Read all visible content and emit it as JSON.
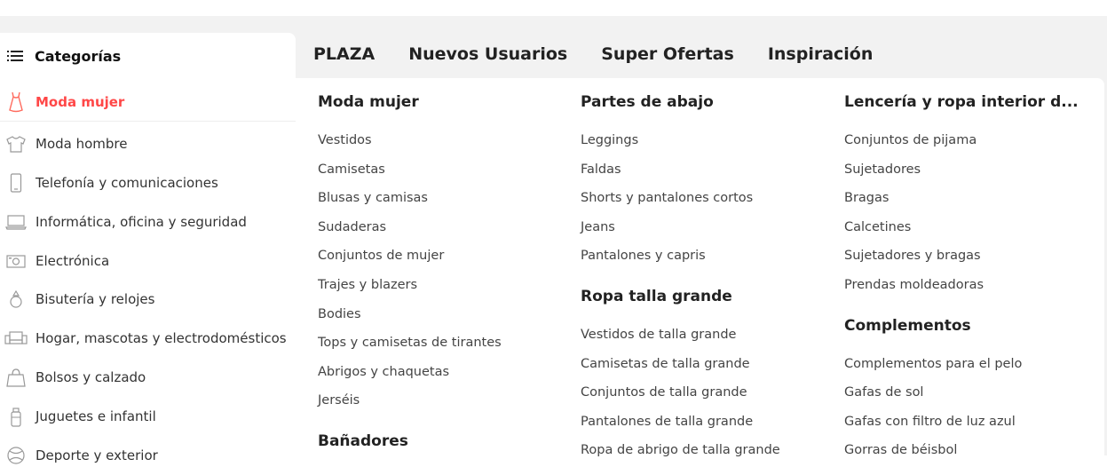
{
  "sidebar": {
    "header": {
      "icon": "list-icon",
      "title": "Categorías"
    },
    "items": [
      {
        "icon": "dress-icon",
        "label": "Moda mujer",
        "active": true
      },
      {
        "icon": "shirt-icon",
        "label": "Moda hombre"
      },
      {
        "icon": "phone-icon",
        "label": "Telefonía y comunicaciones"
      },
      {
        "icon": "laptop-icon",
        "label": "Informática, oficina y seguridad"
      },
      {
        "icon": "camera-icon",
        "label": "Electrónica"
      },
      {
        "icon": "ring-icon",
        "label": "Bisutería y relojes"
      },
      {
        "icon": "sofa-icon",
        "label": "Hogar, mascotas y electrodomésticos"
      },
      {
        "icon": "bag-icon",
        "label": "Bolsos y calzado"
      },
      {
        "icon": "bottle-icon",
        "label": "Juguetes e infantil"
      },
      {
        "icon": "ball-icon",
        "label": "Deporte y exterior"
      }
    ]
  },
  "nav": {
    "tabs": [
      "PLAZA",
      "Nuevos Usuarios",
      "Super Ofertas",
      "Inspiración"
    ]
  },
  "menu": {
    "columns": [
      {
        "groups": [
          {
            "title": "Moda mujer",
            "links": [
              "Vestidos",
              "Camisetas",
              "Blusas y camisas",
              "Sudaderas",
              "Conjuntos de mujer",
              "Trajes y blazers",
              "Bodies",
              "Tops y camisetas de tirantes",
              "Abrigos y chaquetas",
              "Jerséis"
            ]
          },
          {
            "title": "Bañadores",
            "links": []
          }
        ]
      },
      {
        "groups": [
          {
            "title": "Partes de abajo",
            "links": [
              "Leggings",
              "Faldas",
              "Shorts y pantalones cortos",
              "Jeans",
              "Pantalones y capris"
            ]
          },
          {
            "title": "Ropa talla grande",
            "links": [
              "Vestidos de talla grande",
              "Camisetas de talla grande",
              "Conjuntos de talla grande",
              "Pantalones de talla grande",
              "Ropa de abrigo de talla grande"
            ]
          }
        ]
      },
      {
        "groups": [
          {
            "title": "Lencería y ropa interior d...",
            "links": [
              "Conjuntos de pijama",
              "Sujetadores",
              "Bragas",
              "Calcetines",
              "Sujetadores y bragas",
              "Prendas moldeadoras"
            ]
          },
          {
            "title": "Complementos",
            "links": [
              "Complementos para el pelo",
              "Gafas de sol",
              "Gafas con filtro de luz azul",
              "Gorras de béisbol"
            ]
          }
        ]
      }
    ]
  },
  "colors": {
    "accent": "#ff4747",
    "bar": "#f2f2f2",
    "text": "#222222",
    "icon": "#999999"
  }
}
